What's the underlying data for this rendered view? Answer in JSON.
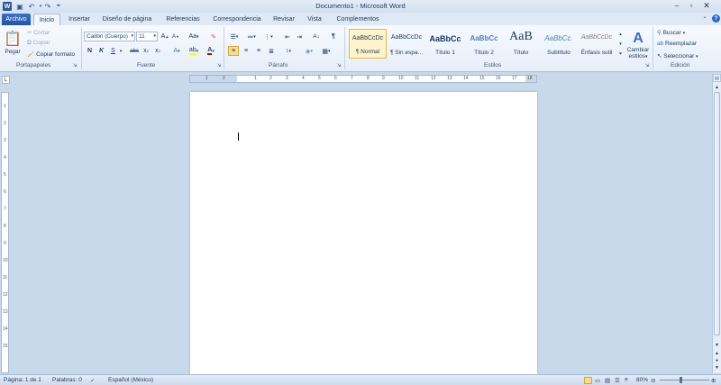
{
  "window": {
    "title": "Documento1 - Microsoft Word"
  },
  "tabs": [
    "Archivo",
    "Inicio",
    "Insertar",
    "Diseño de página",
    "Referencias",
    "Correspondencia",
    "Revisar",
    "Vista",
    "Complementos"
  ],
  "clipboard": {
    "paste": "Pegar",
    "cut": "Cortar",
    "copy": "Copiar",
    "format_painter": "Copiar formato",
    "group_label": "Portapapeles"
  },
  "font": {
    "family": "Calibri (Cuerpo)",
    "size": "11",
    "group_label": "Fuente",
    "aa_label": "Aa"
  },
  "paragraph": {
    "group_label": "Párrafo"
  },
  "styles": {
    "group_label": "Estilos",
    "items": [
      {
        "sample": "AaBbCcDc",
        "name": "¶ Normal"
      },
      {
        "sample": "AaBbCcDc",
        "name": "¶ Sin espa..."
      },
      {
        "sample": "AaBbCc",
        "name": "Título 1"
      },
      {
        "sample": "AaBbCc",
        "name": "Título 2"
      },
      {
        "sample": "AaB",
        "name": "Título"
      },
      {
        "sample": "AaBbCc.",
        "name": "Subtítulo"
      },
      {
        "sample": "AaBbCcDc",
        "name": "Énfasis sutil"
      }
    ],
    "change_styles_line1": "Cambiar",
    "change_styles_line2": "estilos"
  },
  "editing": {
    "find": "Buscar",
    "replace": "Reemplazar",
    "select": "Seleccionar",
    "group_label": "Edición"
  },
  "ruler": {
    "h_numbers": [
      "1",
      "2",
      "1",
      "2",
      "3",
      "4",
      "5",
      "6",
      "7",
      "8",
      "9",
      "10",
      "11",
      "12",
      "13",
      "14",
      "15",
      "16",
      "17",
      "18"
    ],
    "v_numbers": [
      "1",
      "2",
      "3",
      "4",
      "5",
      "6",
      "7",
      "8",
      "9",
      "10",
      "11",
      "12",
      "13",
      "14",
      "15"
    ]
  },
  "status": {
    "page": "Página: 1 de 1",
    "words": "Palabras: 0",
    "language": "Español (México)",
    "zoom": "80%"
  },
  "colors": {
    "accent": "#2b579a",
    "file_tab": "#2354a3",
    "highlight": "#ffff00",
    "font_color": "#c00000"
  }
}
